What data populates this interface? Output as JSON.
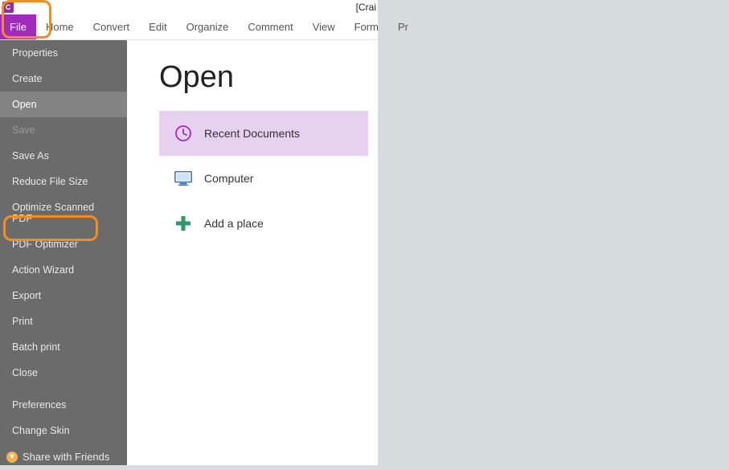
{
  "title": "[Crai",
  "ribbon": {
    "tabs": [
      {
        "label": "File",
        "active": true
      },
      {
        "label": "Home"
      },
      {
        "label": "Convert"
      },
      {
        "label": "Edit"
      },
      {
        "label": "Organize"
      },
      {
        "label": "Comment"
      },
      {
        "label": "View"
      },
      {
        "label": "Form"
      },
      {
        "label": "Pr"
      }
    ]
  },
  "sidebar": {
    "items": [
      {
        "label": "Properties"
      },
      {
        "label": "Create"
      },
      {
        "label": "Open",
        "selected": true
      },
      {
        "label": "Save",
        "disabled": true
      },
      {
        "label": "Save As"
      },
      {
        "label": "Reduce File Size",
        "highlighted": true
      },
      {
        "label": "Optimize Scanned PDF"
      },
      {
        "label": "PDF Optimizer"
      },
      {
        "label": "Action Wizard"
      },
      {
        "label": "Export"
      },
      {
        "label": "Print"
      },
      {
        "label": "Batch print"
      },
      {
        "label": "Close"
      }
    ],
    "footer": [
      {
        "label": "Preferences"
      },
      {
        "label": "Change Skin"
      }
    ],
    "share": {
      "label": "Share with Friends"
    }
  },
  "content": {
    "title": "Open",
    "locations": [
      {
        "label": "Recent Documents",
        "icon": "clock",
        "active": true
      },
      {
        "label": "Computer",
        "icon": "computer"
      },
      {
        "label": "Add a place",
        "icon": "plus"
      }
    ]
  }
}
